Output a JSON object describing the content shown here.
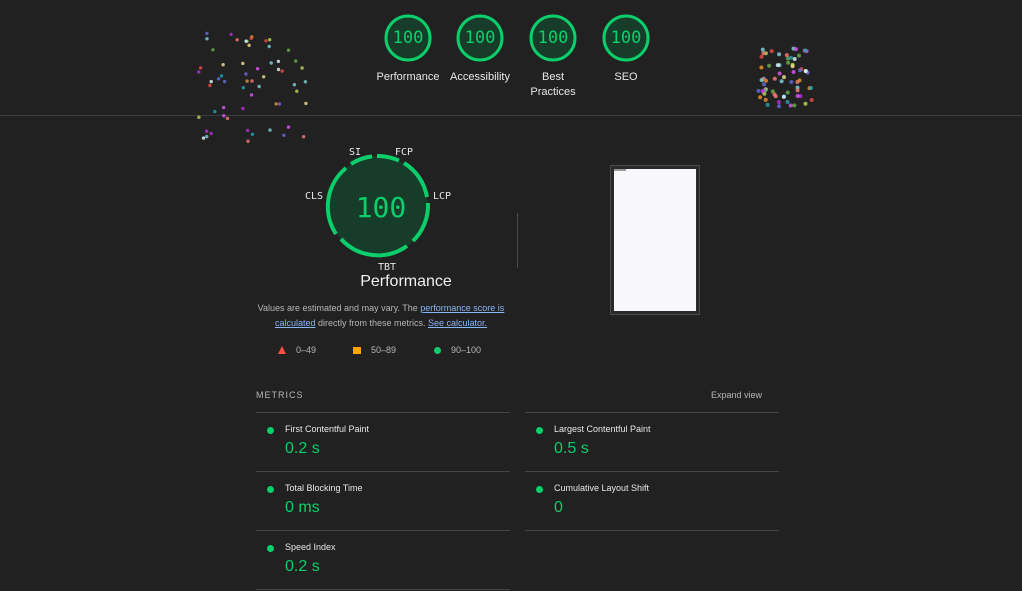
{
  "categories": [
    {
      "score": "100",
      "label": "Performance"
    },
    {
      "score": "100",
      "label": "Accessibility"
    },
    {
      "score": "100",
      "label": "Best Practices"
    },
    {
      "score": "100",
      "label": "SEO"
    }
  ],
  "performance": {
    "score": "100",
    "title": "Performance",
    "gauge_labels": {
      "si": "SI",
      "fcp": "FCP",
      "lcp": "LCP",
      "tbt": "TBT",
      "cls": "CLS"
    },
    "desc_prefix": "Values are estimated and may vary. The ",
    "desc_link1": "performance score is calculated",
    "desc_middle": " directly from these metrics. ",
    "desc_link2": "See calculator."
  },
  "legend": {
    "fail": "0–49",
    "average": "50–89",
    "pass": "90–100"
  },
  "metrics_header": "METRICS",
  "expand_label": "Expand view",
  "metrics_left": [
    {
      "title": "First Contentful Paint",
      "value": "0.2 s"
    },
    {
      "title": "Total Blocking Time",
      "value": "0 ms"
    },
    {
      "title": "Speed Index",
      "value": "0.2 s"
    }
  ],
  "metrics_right": [
    {
      "title": "Largest Contentful Paint",
      "value": "0.5 s"
    },
    {
      "title": "Cumulative Layout Shift",
      "value": "0"
    }
  ],
  "colors": {
    "pass": "#0cce6b",
    "average": "#ffa400",
    "fail": "#ff4e42",
    "background": "#212121"
  }
}
